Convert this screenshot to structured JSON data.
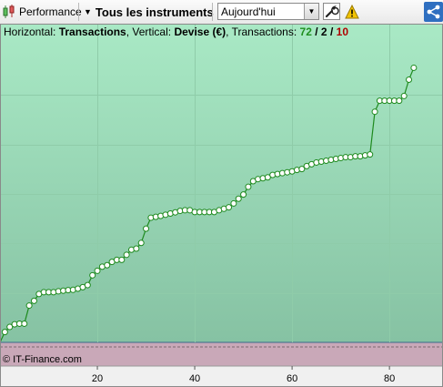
{
  "toolbar": {
    "performance_label": "Performance",
    "instruments_label": "Tous les instruments",
    "period_value": "Aujourd'hui",
    "wrench_icon": "wrench-icon",
    "warning_icon": "warning-icon",
    "share_icon": "share-icon"
  },
  "info": {
    "horizontal_prefix": "Horizontal:",
    "horizontal_value": "Transactions",
    "vertical_prefix": ", Vertical:",
    "vertical_value": "Devise (€)",
    "transactions_prefix": ", Transactions:",
    "count_green": "72",
    "slash1": "/",
    "count_black": "2",
    "slash2": "/",
    "count_red": "10"
  },
  "copyright": "© IT-Finance.com",
  "colors": {
    "line": "#1e8a1e",
    "loss_segment": "#b00000",
    "marker_fill": "#ffffff",
    "background_top": "#a8e8c4",
    "background_bottom": "#86c2a3",
    "bottom_band": "#c9a8b8"
  },
  "chart_data": {
    "type": "line",
    "xlabel": "",
    "ylabel": "",
    "xlim": [
      0,
      91
    ],
    "ylim": [
      0,
      100
    ],
    "xticks": [
      20,
      40,
      60,
      80
    ],
    "x": [
      1,
      2,
      3,
      4,
      5,
      6,
      7,
      8,
      9,
      10,
      11,
      12,
      13,
      14,
      15,
      16,
      17,
      18,
      19,
      20,
      21,
      22,
      23,
      24,
      25,
      26,
      27,
      28,
      29,
      30,
      31,
      32,
      33,
      34,
      35,
      36,
      37,
      38,
      39,
      40,
      41,
      42,
      43,
      44,
      45,
      46,
      47,
      48,
      49,
      50,
      51,
      52,
      53,
      54,
      55,
      56,
      57,
      58,
      59,
      60,
      61,
      62,
      63,
      64,
      65,
      66,
      67,
      68,
      69,
      70,
      71,
      72,
      73,
      74,
      75,
      76,
      77,
      78,
      79,
      80,
      81,
      82,
      83,
      84,
      85
    ],
    "y": [
      3.5,
      5.2,
      6.1,
      6.3,
      6.3,
      12.4,
      14.0,
      16.3,
      16.9,
      16.9,
      16.9,
      17.2,
      17.4,
      17.6,
      17.7,
      18.1,
      18.6,
      19.3,
      22.6,
      24.1,
      25.5,
      26.0,
      27.1,
      27.8,
      27.8,
      29.5,
      31.2,
      31.6,
      33.5,
      38.3,
      42.0,
      42.3,
      42.6,
      43.0,
      43.4,
      43.8,
      44.3,
      44.5,
      44.5,
      43.9,
      43.9,
      43.9,
      43.9,
      43.9,
      44.5,
      45.0,
      45.5,
      46.8,
      48.4,
      49.8,
      52.4,
      54.3,
      55.0,
      55.3,
      55.6,
      56.4,
      56.7,
      57.0,
      57.3,
      57.6,
      58.1,
      58.4,
      59.4,
      60.0,
      60.6,
      60.9,
      61.2,
      61.5,
      61.8,
      62.1,
      62.4,
      62.4,
      62.7,
      62.7,
      63.0,
      63.3,
      77.7,
      81.4,
      81.4,
      81.4,
      81.4,
      81.4,
      83.0,
      88.5,
      92.5
    ],
    "baseline": 0
  }
}
